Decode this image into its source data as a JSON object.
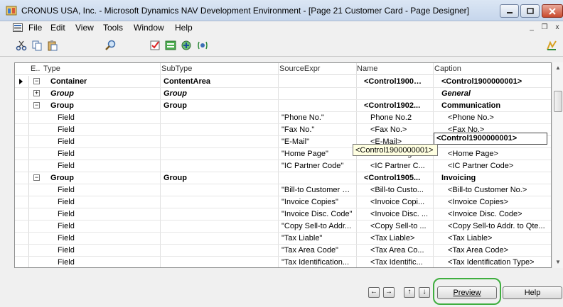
{
  "window": {
    "title": "CRONUS USA, Inc. - Microsoft Dynamics NAV Development Environment - [Page 21 Customer Card - Page Designer]",
    "minimize_icon": "minimize-icon",
    "maximize_icon": "maximize-icon",
    "close_icon": "close-icon"
  },
  "menu": {
    "items": [
      "File",
      "Edit",
      "View",
      "Tools",
      "Window",
      "Help"
    ],
    "mdi_minimize": "_",
    "mdi_restore": "❐",
    "mdi_close": "x"
  },
  "toolbar": {
    "icons": [
      "cut-icon",
      "copy-icon",
      "paste-icon",
      "find-icon",
      "properties-icon",
      "field-menu-icon",
      "c-al-symbols-icon",
      "action-designer-icon",
      "help-icon"
    ]
  },
  "grid": {
    "headers": {
      "e": "E..",
      "type": "Type",
      "subtype": "SubType",
      "sourceexpr": "SourceExpr",
      "name": "Name",
      "caption": "Caption"
    },
    "rows": [
      {
        "expander": "−",
        "type": "Container",
        "subtype": "ContentArea",
        "source": "",
        "name": "<Control190000...",
        "caption": "<Control1900000001>",
        "style": "bold",
        "current": true
      },
      {
        "expander": "+",
        "type": "Group",
        "subtype": "Group",
        "source": "",
        "name": "",
        "caption": "General",
        "style": "bolditalic"
      },
      {
        "expander": "−",
        "type": "Group",
        "subtype": "Group",
        "source": "",
        "name": "<Control1902...",
        "caption": "Communication",
        "style": "bold"
      },
      {
        "expander": "",
        "type": "Field",
        "subtype": "",
        "source": "\"Phone No.\"",
        "name": "Phone No.2",
        "caption": "<Phone No.>",
        "style": ""
      },
      {
        "expander": "",
        "type": "Field",
        "subtype": "",
        "source": "\"Fax No.\"",
        "name": "<Fax No.>",
        "caption": "<Fax No.>",
        "style": ""
      },
      {
        "expander": "",
        "type": "Field",
        "subtype": "",
        "source": "\"E-Mail\"",
        "name": "<E-Mail>",
        "caption": "<E-Mail>",
        "style": ""
      },
      {
        "expander": "",
        "type": "Field",
        "subtype": "",
        "source": "\"Home Page\"",
        "name": "<Home Page>",
        "caption": "<Home Page>",
        "style": ""
      },
      {
        "expander": "",
        "type": "Field",
        "subtype": "",
        "source": "\"IC Partner Code\"",
        "name": "<IC Partner C...",
        "caption": "<IC Partner Code>",
        "style": ""
      },
      {
        "expander": "−",
        "type": "Group",
        "subtype": "Group",
        "source": "",
        "name": "<Control1905...",
        "caption": "Invoicing",
        "style": "bold"
      },
      {
        "expander": "",
        "type": "Field",
        "subtype": "",
        "source": "\"Bill-to Customer No.\"",
        "name": "<Bill-to Custo...",
        "caption": "<Bill-to Customer No.>",
        "style": ""
      },
      {
        "expander": "",
        "type": "Field",
        "subtype": "",
        "source": "\"Invoice Copies\"",
        "name": "<Invoice Copi...",
        "caption": "<Invoice Copies>",
        "style": ""
      },
      {
        "expander": "",
        "type": "Field",
        "subtype": "",
        "source": "\"Invoice Disc. Code\"",
        "name": "<Invoice Disc. ...",
        "caption": "<Invoice Disc. Code>",
        "style": ""
      },
      {
        "expander": "",
        "type": "Field",
        "subtype": "",
        "source": "\"Copy Sell-to Addr...",
        "name": "<Copy Sell-to ...",
        "caption": "<Copy Sell-to Addr. to Qte...",
        "style": ""
      },
      {
        "expander": "",
        "type": "Field",
        "subtype": "",
        "source": "\"Tax Liable\"",
        "name": "<Tax Liable>",
        "caption": "<Tax Liable>",
        "style": ""
      },
      {
        "expander": "",
        "type": "Field",
        "subtype": "",
        "source": "\"Tax Area Code\"",
        "name": "<Tax Area Co...",
        "caption": "<Tax Area Code>",
        "style": ""
      },
      {
        "expander": "",
        "type": "Field",
        "subtype": "",
        "source": "\"Tax Identification...",
        "name": "<Tax Identific...",
        "caption": "<Tax Identification Type>",
        "style": ""
      }
    ],
    "tooltip": "<Control1900000001>",
    "edit_value": "<Control1900000001>"
  },
  "buttons": {
    "preview": "Preview",
    "help": "Help",
    "nav_left": "←",
    "nav_right": "→",
    "nav_up": "↑",
    "nav_down": "↓"
  }
}
